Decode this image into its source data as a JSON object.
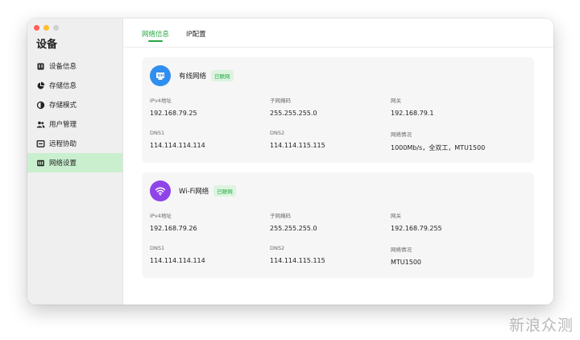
{
  "sidebar": {
    "title": "设备",
    "items": [
      {
        "label": "设备信息",
        "icon": "device-info-icon",
        "active": false
      },
      {
        "label": "存储信息",
        "icon": "storage-pie-icon",
        "active": false
      },
      {
        "label": "存储模式",
        "icon": "storage-mode-icon",
        "active": false
      },
      {
        "label": "用户管理",
        "icon": "users-icon",
        "active": false
      },
      {
        "label": "远程协助",
        "icon": "remote-assist-icon",
        "active": false
      },
      {
        "label": "网络设置",
        "icon": "network-settings-icon",
        "active": true
      }
    ]
  },
  "tabs": [
    {
      "label": "网络信息",
      "active": true
    },
    {
      "label": "IP配置",
      "active": false
    }
  ],
  "wired": {
    "title": "有线网络",
    "status": "已联网",
    "icon": "ethernet-icon",
    "icon_color": "#2f8ff0",
    "fields": [
      {
        "label": "IPv4地址",
        "value": "192.168.79.25"
      },
      {
        "label": "子网掩码",
        "value": "255.255.255.0"
      },
      {
        "label": "网关",
        "value": "192.168.79.1"
      },
      {
        "label": "DNS1",
        "value": "114.114.114.114"
      },
      {
        "label": "DNS2",
        "value": "114.114.115.115"
      },
      {
        "label": "网络情况",
        "value": "1000Mb/s，全双工，MTU1500"
      }
    ]
  },
  "wifi": {
    "title": "Wi-Fi网络",
    "status": "已联网",
    "icon": "wifi-icon",
    "icon_color": "#8e44e8",
    "fields": [
      {
        "label": "IPv4地址",
        "value": "192.168.79.26"
      },
      {
        "label": "子网掩码",
        "value": "255.255.255.0"
      },
      {
        "label": "网关",
        "value": "192.168.79.255"
      },
      {
        "label": "DNS1",
        "value": "114.114.114.114"
      },
      {
        "label": "DNS2",
        "value": "114.114.115.115"
      },
      {
        "label": "网络情况",
        "value": "MTU1500"
      }
    ]
  },
  "watermark": "新浪众测",
  "colors": {
    "accent": "#27a844",
    "active_bg": "#c9efce"
  }
}
